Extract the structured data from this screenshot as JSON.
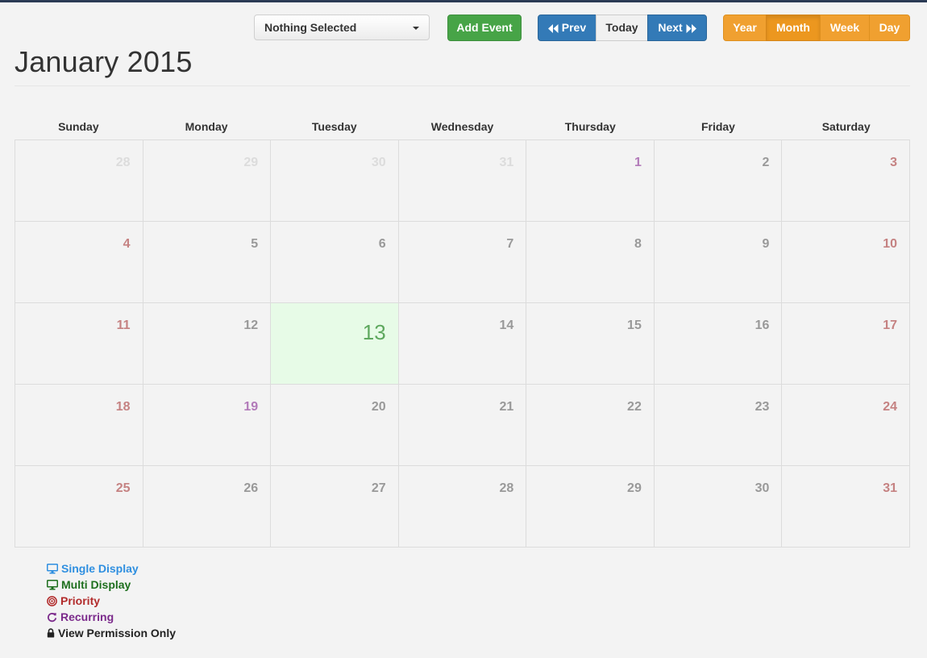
{
  "toolbar": {
    "select_value": "Nothing Selected",
    "add_event": "Add Event",
    "prev": "Prev",
    "today": "Today",
    "next": "Next",
    "views": [
      "Year",
      "Month",
      "Week",
      "Day"
    ],
    "active_view": "Month"
  },
  "title": "January 2015",
  "weekdays": [
    "Sunday",
    "Monday",
    "Tuesday",
    "Wednesday",
    "Thursday",
    "Friday",
    "Saturday"
  ],
  "weeks": [
    [
      "28",
      "29",
      "30",
      "31",
      "1",
      "2",
      "3"
    ],
    [
      "4",
      "5",
      "6",
      "7",
      "8",
      "9",
      "10"
    ],
    [
      "11",
      "12",
      "13",
      "14",
      "15",
      "16",
      "17"
    ],
    [
      "18",
      "19",
      "20",
      "21",
      "22",
      "23",
      "24"
    ],
    [
      "25",
      "26",
      "27",
      "28",
      "29",
      "30",
      "31"
    ]
  ],
  "today_day": "13",
  "legend": {
    "single": "Single Display",
    "multi": "Multi Display",
    "priority": "Priority",
    "recurring": "Recurring",
    "view": "View Permission Only"
  },
  "colors": {
    "add_button": "#47a447",
    "nav_button": "#337ab7",
    "view_button": "#f0a030",
    "today_bg": "#e7fbe7",
    "weekend_text": "#c58282"
  }
}
